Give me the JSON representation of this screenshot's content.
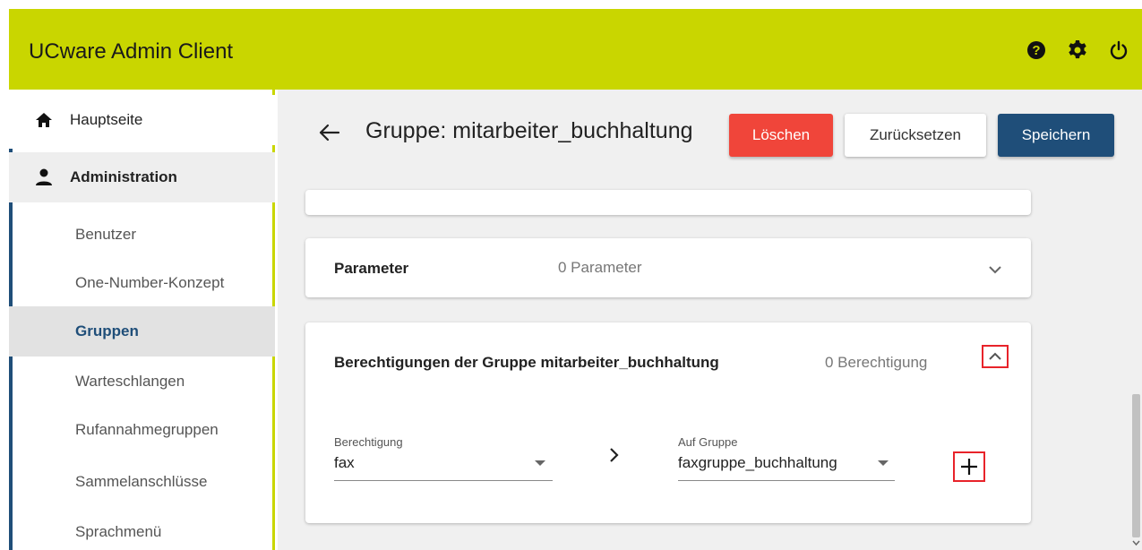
{
  "app": {
    "title": "UCware Admin Client"
  },
  "topbar": {
    "icons": [
      "help-icon",
      "gear-icon",
      "power-icon"
    ]
  },
  "sidebar": {
    "home": {
      "label": "Hauptseite",
      "icon": "home-icon"
    },
    "admin": {
      "label": "Administration",
      "icon": "person-icon"
    },
    "items": [
      {
        "label": "Benutzer"
      },
      {
        "label": "One-Number-Konzept"
      },
      {
        "label": "Gruppen",
        "active": true
      },
      {
        "label": "Warteschlangen"
      },
      {
        "label": "Rufannahmegruppen"
      },
      {
        "label": "Sammelanschlüsse"
      },
      {
        "label": "Sprachmenü"
      }
    ]
  },
  "header": {
    "title": "Gruppe: mitarbeiter_buchhaltung",
    "delete_label": "Löschen",
    "reset_label": "Zurücksetzen",
    "save_label": "Speichern"
  },
  "parameter_card": {
    "name": "Parameter",
    "value": "0 Parameter"
  },
  "permission_card": {
    "name": "Berechtigungen der Gruppe mitarbeiter_buchhaltung",
    "value": "0 Berechtigung",
    "permission_field": {
      "label": "Berechtigung",
      "value": "fax"
    },
    "group_field": {
      "label": "Auf Gruppe",
      "value": "faxgruppe_buchhaltung"
    }
  },
  "colors": {
    "topbar": "#c9d600",
    "accent": "#1f4e79",
    "danger": "#f0453a",
    "highlight": "#e8232a"
  }
}
